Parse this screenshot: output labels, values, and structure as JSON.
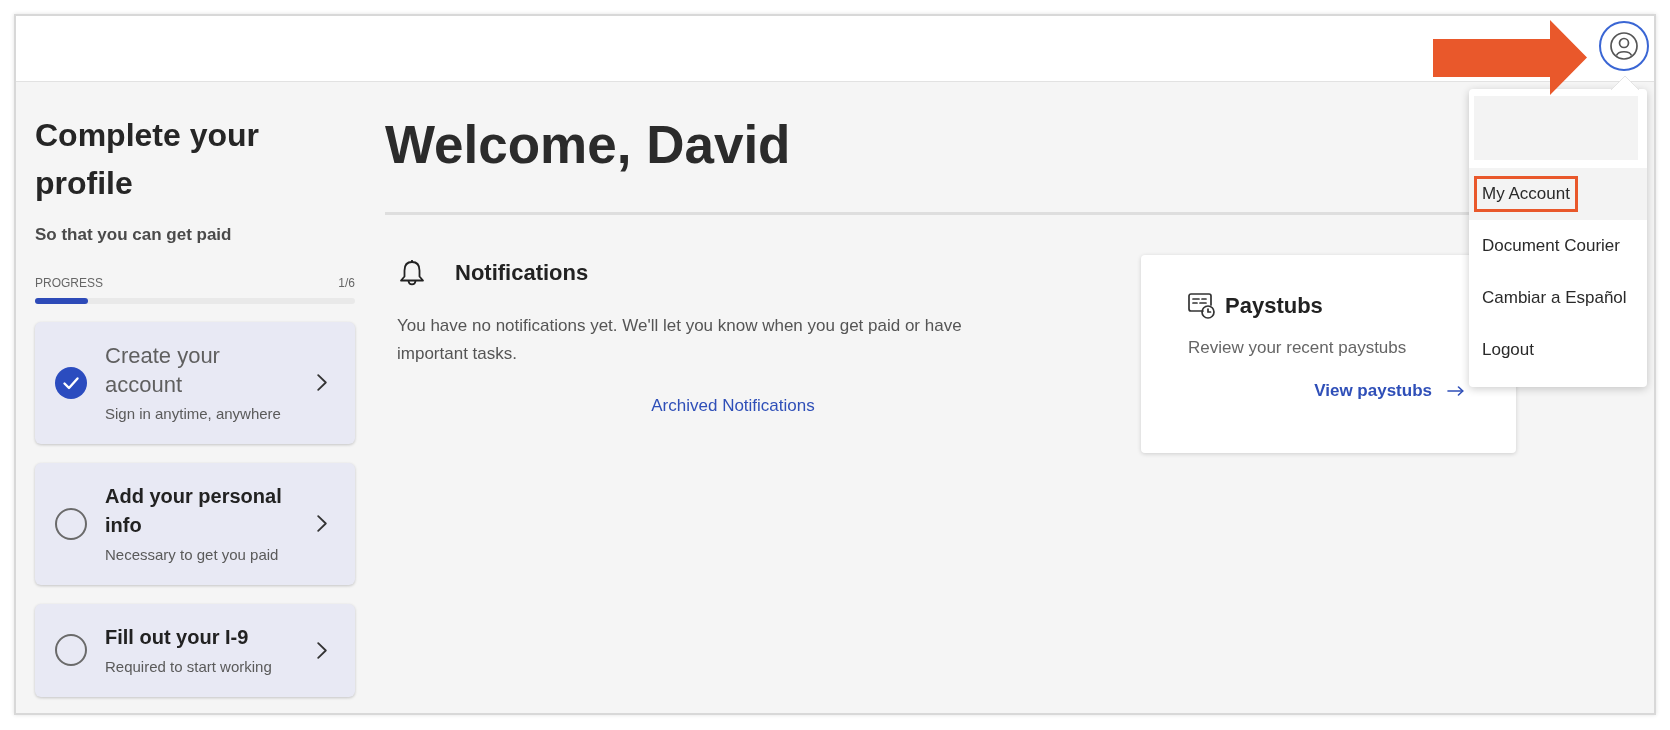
{
  "account_menu": {
    "open": true,
    "items": [
      {
        "label": "My Account",
        "selected": true,
        "annotated": true
      },
      {
        "label": "Document Courier",
        "selected": false,
        "annotated": false
      },
      {
        "label": "Cambiar a Español",
        "selected": false,
        "annotated": false
      },
      {
        "label": "Logout",
        "selected": false,
        "annotated": false
      }
    ]
  },
  "sidebar": {
    "title": "Complete your profile",
    "subtitle": "So that you can get paid",
    "progress": {
      "label": "PROGRESS",
      "count": "1/6",
      "level": 0.167
    },
    "steps": [
      {
        "title": "Create your account",
        "subtitle": "Sign in anytime, anywhere",
        "done": true
      },
      {
        "title": "Add your personal info",
        "subtitle": "Necessary to get you paid",
        "done": false
      },
      {
        "title": "Fill out your I-9",
        "subtitle": "Required to start working",
        "done": false
      }
    ]
  },
  "main": {
    "greeting": "Welcome, David",
    "notifications": {
      "title": "Notifications",
      "message": "You have no notifications yet. We'll let you know when you get paid or have important tasks.",
      "link": "Archived Notifications"
    },
    "paystubs_card": {
      "title": "Paystubs",
      "description": "Review your recent paystubs",
      "link": "View paystubs"
    }
  }
}
